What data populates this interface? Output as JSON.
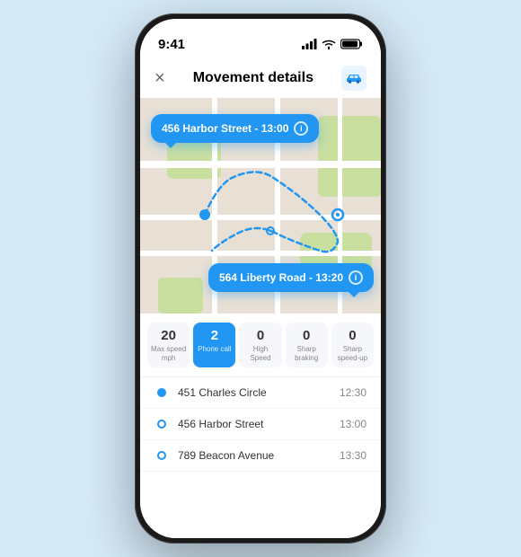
{
  "background": "#d6eaf8",
  "status_bar": {
    "time": "9:41",
    "signal": "●●●●",
    "wifi": "wifi",
    "battery": "battery"
  },
  "header": {
    "close_label": "×",
    "title": "Movement details",
    "car_icon": "🚗"
  },
  "map": {
    "tooltip_start": {
      "text": "456 Harbor Street - 13:00",
      "info_label": "i"
    },
    "tooltip_end": {
      "text": "564 Liberty Road - 13:20",
      "info_label": "i"
    }
  },
  "stats": [
    {
      "value": "20",
      "label": "Max speed mph",
      "active": false
    },
    {
      "value": "2",
      "label": "Phone call",
      "active": true
    },
    {
      "value": "0",
      "label": "High Speed",
      "active": false
    },
    {
      "value": "0",
      "label": "Sharp braking",
      "active": false
    },
    {
      "value": "0",
      "label": "Sharp speed-up",
      "active": false
    }
  ],
  "trip_items": [
    {
      "address": "451 Charles Circle",
      "time": "12:30",
      "filled": true
    },
    {
      "address": "456 Harbor Street",
      "time": "13:00",
      "filled": false
    },
    {
      "address": "789 Beacon Avenue",
      "time": "13:30",
      "filled": false
    }
  ]
}
